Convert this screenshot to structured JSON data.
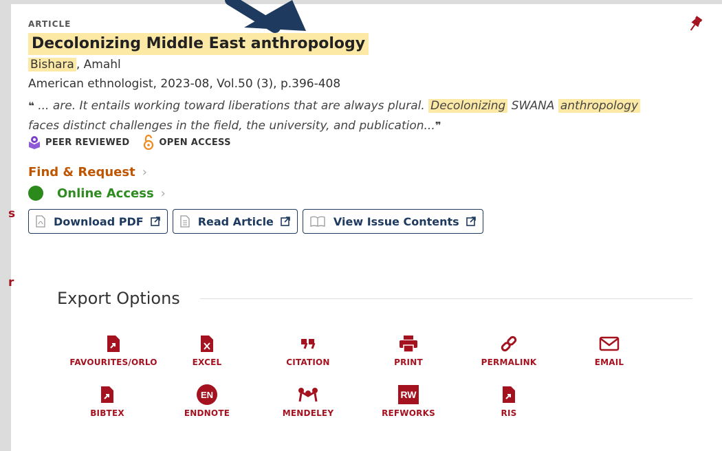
{
  "record": {
    "type_label": "ARTICLE",
    "title": "Decolonizing Middle East anthropology",
    "author_highlight": "Bishara",
    "author_rest": ", Amahl",
    "source": "American ethnologist, 2023-08, Vol.50 (3), p.396-408",
    "snippet": {
      "part1": "... are. It entails working toward liberations that are always plural.",
      "hl1": "Decolonizing",
      "part2": "SWANA",
      "hl2": "anthropology",
      "part3": "faces distinct challenges in the field, the university, and publication..."
    },
    "badges": {
      "peer_reviewed": "PEER REVIEWED",
      "open_access": "OPEN ACCESS"
    },
    "find_request": "Find & Request",
    "online_access": "Online Access",
    "buttons": {
      "download_pdf": "Download PDF",
      "read_article": "Read Article",
      "view_issue": "View Issue Contents"
    }
  },
  "left_fragments": {
    "a": "s",
    "b": "r"
  },
  "export": {
    "title": "Export Options",
    "options": [
      {
        "label": "FAVOURITES/ORLO",
        "icon": "file-arrow-icon"
      },
      {
        "label": "EXCEL",
        "icon": "excel-icon"
      },
      {
        "label": "CITATION",
        "icon": "quote-icon"
      },
      {
        "label": "PRINT",
        "icon": "printer-icon"
      },
      {
        "label": "PERMALINK",
        "icon": "link-icon"
      },
      {
        "label": "EMAIL",
        "icon": "envelope-icon"
      },
      {
        "label": "BIBTEX",
        "icon": "file-arrow-icon"
      },
      {
        "label": "ENDNOTE",
        "icon": "endnote-icon",
        "glyph": "EN"
      },
      {
        "label": "MENDELEY",
        "icon": "mendeley-icon"
      },
      {
        "label": "REFWORKS",
        "icon": "refworks-icon",
        "glyph": "RW"
      },
      {
        "label": "RIS",
        "icon": "file-arrow-icon"
      }
    ]
  },
  "colors": {
    "accent_red": "#a5121f",
    "highlight": "#fde9a6",
    "navy": "#1e3a5f",
    "find_orange": "#c05500",
    "online_green": "#2c8a1c"
  }
}
